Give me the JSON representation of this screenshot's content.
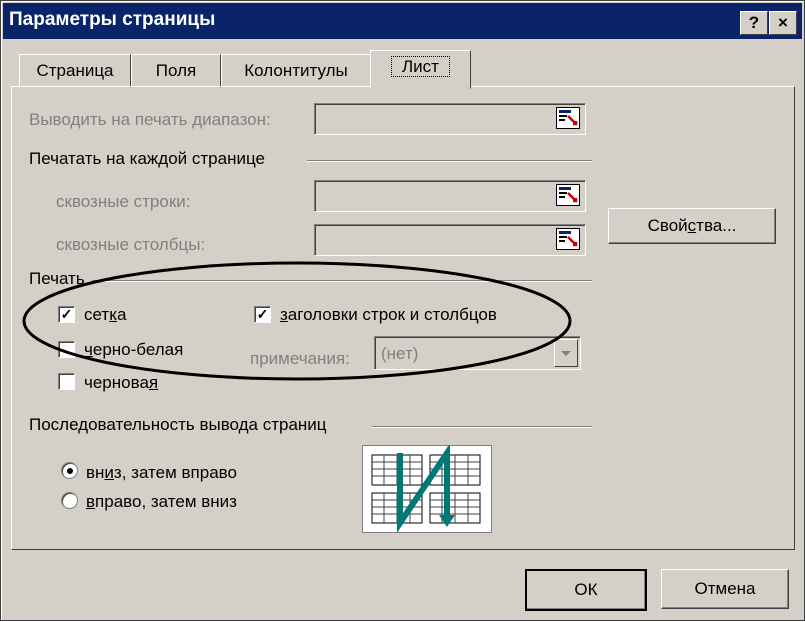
{
  "window": {
    "title": "Параметры страницы",
    "help_label": "?",
    "close_label": "×"
  },
  "tabs": [
    {
      "label": "Страница"
    },
    {
      "label": "Поля"
    },
    {
      "label": "Колонтитулы"
    },
    {
      "label": "Лист",
      "active": true
    }
  ],
  "sheet": {
    "print_area_label": "Выводить на печать диапазон:",
    "print_titles_group": "Печатать на каждой странице",
    "rows_label": "сквозные строки:",
    "cols_label": "сквозные столбцы:",
    "print_group": "Печать",
    "gridlines": {
      "pre": "сет",
      "u": "к",
      "post": "а",
      "checked": true
    },
    "headings": {
      "pre": "",
      "u": "з",
      "post": "аголовки строк и столбцов",
      "checked": true
    },
    "bw": {
      "pre": "",
      "u": "ч",
      "post": "ерно-белая",
      "checked": false
    },
    "draft": {
      "pre": "чернова",
      "u": "я",
      "post": "",
      "checked": false
    },
    "comments_label": "примечания:",
    "comments_value": "(нет)",
    "order_group": "Последовательность вывода страниц",
    "down_then_over": {
      "pre": "вн",
      "u": "и",
      "post": "з, затем вправо",
      "selected": true
    },
    "over_then_down": {
      "pre": "",
      "u": "в",
      "post": "право, затем вниз",
      "selected": false
    }
  },
  "buttons": {
    "properties": {
      "pre": "Свой",
      "u": "с",
      "post": "тва..."
    },
    "ok": "ОК",
    "cancel": "Отмена"
  },
  "colors": {
    "title_bg": "#0a246a",
    "face": "#d4d0c8",
    "arrow_teal": "#007878"
  }
}
